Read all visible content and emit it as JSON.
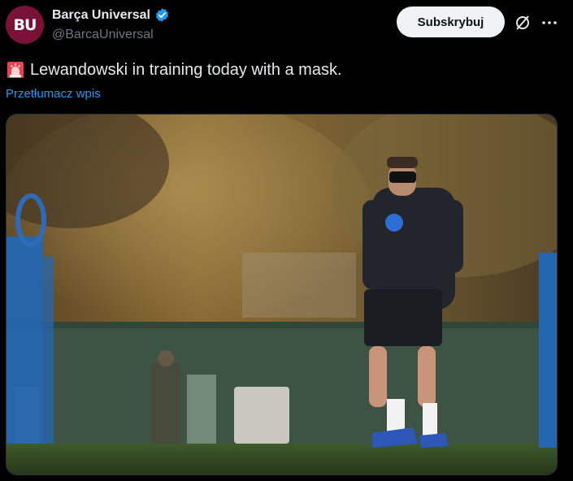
{
  "author": {
    "avatar_text": "BU",
    "display_name": "Barça Universal",
    "handle": "@BarcaUniversal",
    "verified": true
  },
  "actions": {
    "subscribe_label": "Subskrybuj"
  },
  "tweet": {
    "emoji_icon": "police-siren-icon",
    "text": "Lewandowski in training today with a mask.",
    "translate_label": "Przetłumacz wpis"
  },
  "media": {
    "type": "photo"
  },
  "colors": {
    "avatar_bg": "#7a1238",
    "verified": "#1d9bf0",
    "link": "#1d9bf0",
    "button_bg": "#eff3f4"
  }
}
